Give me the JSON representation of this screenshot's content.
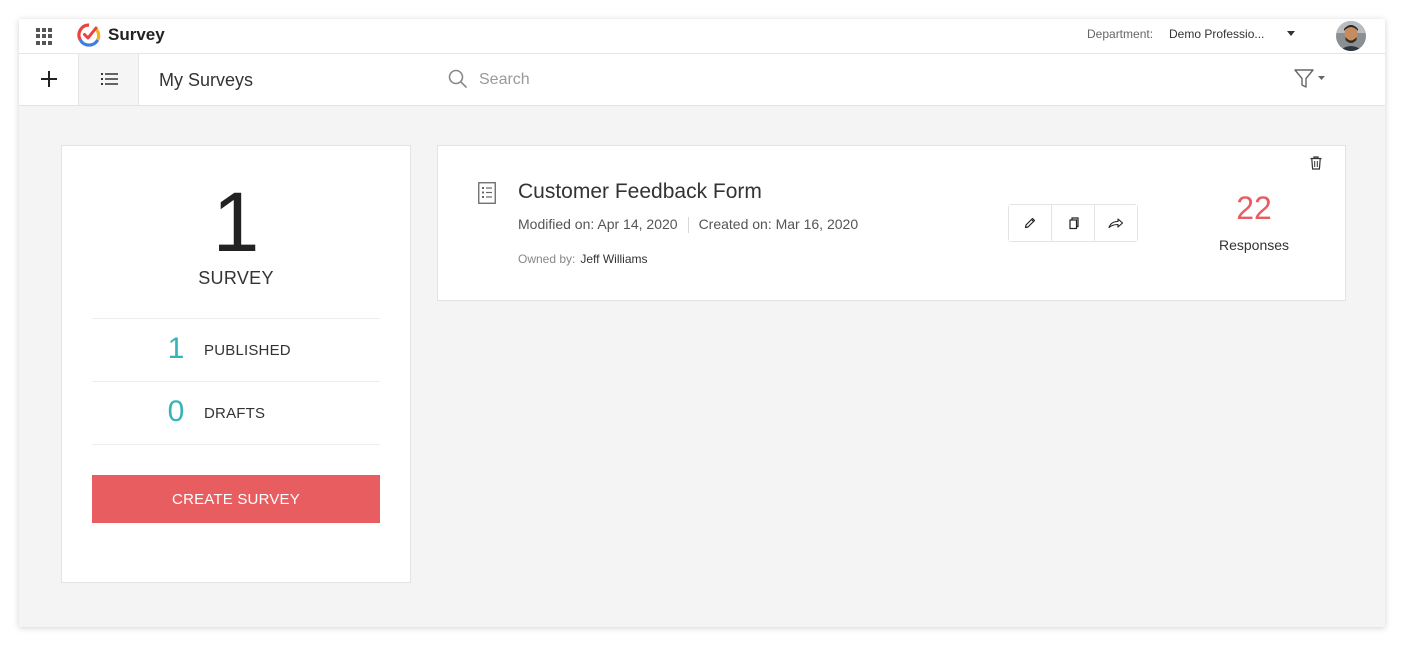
{
  "app": {
    "name": "Survey",
    "logo_icon": "survey-logo-icon",
    "colors": {
      "brand_red": "#e85d5f",
      "accent_teal": "#36b3b8"
    }
  },
  "header": {
    "department_label": "Department:",
    "department_value": "Demo Professio...",
    "apps_icon": "apps-grid-icon",
    "avatar_icon": "user-avatar"
  },
  "toolbar": {
    "page_title": "My Surveys",
    "search_placeholder": "Search",
    "add_icon": "plus-icon",
    "list_icon": "list-icon",
    "filter_icon": "filter-icon"
  },
  "summary": {
    "total_count": "1",
    "total_label": "SURVEY",
    "published_count": "1",
    "published_label": "PUBLISHED",
    "drafts_count": "0",
    "drafts_label": "DRAFTS",
    "create_button": "CREATE SURVEY"
  },
  "surveys": [
    {
      "title": "Customer Feedback Form",
      "modified": "Modified on: Apr 14, 2020",
      "created": "Created on: Mar 16, 2020",
      "owner_label": "Owned by:",
      "owner_name": "Jeff Williams",
      "responses_count": "22",
      "responses_label": "Responses",
      "actions": [
        "edit-icon",
        "copy-icon",
        "share-icon"
      ]
    }
  ]
}
